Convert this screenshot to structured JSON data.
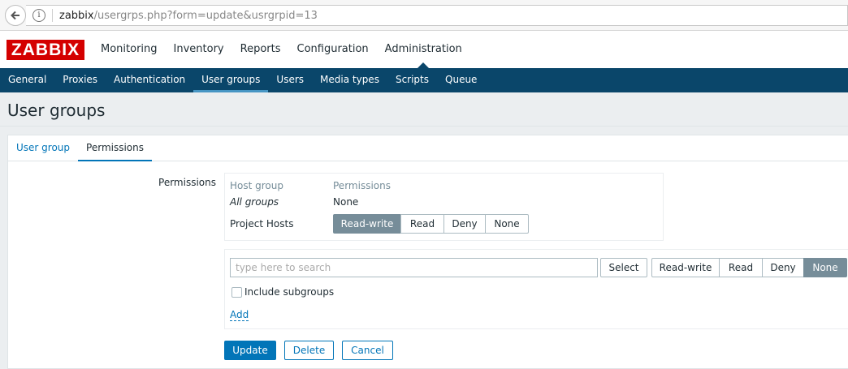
{
  "browser": {
    "url_host": "zabbix",
    "url_path": "/usergrps.php?form=update&usrgrpid=13"
  },
  "header": {
    "logo": "ZABBIX",
    "menu": [
      "Monitoring",
      "Inventory",
      "Reports",
      "Configuration",
      "Administration"
    ],
    "selected_menu": "Administration"
  },
  "subnav": {
    "items": [
      "General",
      "Proxies",
      "Authentication",
      "User groups",
      "Users",
      "Media types",
      "Scripts",
      "Queue"
    ],
    "selected": "User groups"
  },
  "page": {
    "title": "User groups"
  },
  "tabs": [
    "User group",
    "Permissions"
  ],
  "active_tab": "Permissions",
  "permissions": {
    "label": "Permissions",
    "col_host_group": "Host group",
    "col_permissions": "Permissions",
    "rows": [
      {
        "group": "All groups",
        "value": "None"
      },
      {
        "group": "Project Hosts",
        "options": [
          "Read-write",
          "Read",
          "Deny",
          "None"
        ],
        "selected": "Read-write"
      }
    ]
  },
  "add_form": {
    "search_placeholder": "type here to search",
    "select_label": "Select",
    "options": [
      "Read-write",
      "Read",
      "Deny",
      "None"
    ],
    "selected": "None",
    "include_subgroups_label": "Include subgroups",
    "add_label": "Add"
  },
  "actions": {
    "update": "Update",
    "delete": "Delete",
    "cancel": "Cancel"
  },
  "colors": {
    "brand_red": "#d40000",
    "nav_blue": "#0a466a",
    "link_blue": "#0275b8",
    "selected_option": "#768d99"
  }
}
